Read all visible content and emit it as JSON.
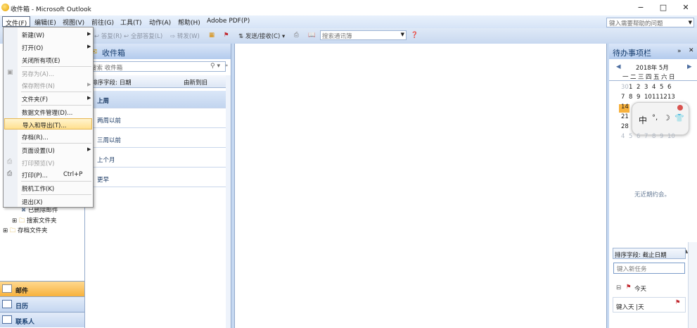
{
  "window": {
    "title": "收件箱 - Microsoft Outlook",
    "controls": [
      "−",
      "□",
      "✕"
    ]
  },
  "menubar": {
    "items": [
      "文件(F)",
      "编辑(E)",
      "视图(V)",
      "前往(G)",
      "工具(T)",
      "动作(A)",
      "帮助(H)",
      "Adobe PDF(P)"
    ],
    "help_placeholder": "键入需要帮助的问题"
  },
  "toolbar": {
    "reply": "答复(R)",
    "reply_all": "全部答复(L)",
    "forward": "转发(W)",
    "send_receive": "发送/接收(C)",
    "contact_search_placeholder": "搜索通讯簿"
  },
  "file_menu": {
    "items": [
      {
        "label": "新建(W)",
        "submenu": true
      },
      {
        "label": "打开(O)",
        "submenu": true
      },
      {
        "label": "关闭所有项(E)"
      },
      {
        "label": "另存为(A)...",
        "disabled": true
      },
      {
        "label": "保存附件(N)",
        "disabled": true,
        "submenu": true
      },
      {
        "label": "文件夹(F)",
        "submenu": true
      },
      {
        "label": "数据文件管理(D)..."
      },
      {
        "label": "导入和导出(T)...",
        "highlighted": true
      },
      {
        "label": "存档(R)..."
      },
      {
        "label": "页面设置(U)",
        "submenu": true
      },
      {
        "label": "打印预览(V)",
        "disabled": true
      },
      {
        "label": "打印(P)...",
        "shortcut": "Ctrl+P"
      },
      {
        "label": "脱机工作(K)"
      },
      {
        "label": "退出(X)"
      }
    ]
  },
  "nav": {
    "folders": [
      "已删除邮件",
      "搜索文件夹",
      "存档文件夹"
    ],
    "buttons": [
      "邮件",
      "日历",
      "联系人"
    ]
  },
  "inbox": {
    "title": "收件箱",
    "search_placeholder": "搜索 收件箱",
    "sort_label": "排序字段: 日期",
    "sort_order": "由新到旧",
    "groups": [
      "上周",
      "两周以前",
      "三周以前",
      "上个月",
      "更早"
    ]
  },
  "todo": {
    "title": "待办事项栏",
    "month": "2018年 5月",
    "weekdays": [
      "一",
      "二",
      "三",
      "四",
      "五",
      "六",
      "日"
    ],
    "weeks": [
      [
        "30",
        "1",
        "2",
        "3",
        "4",
        "5",
        "6"
      ],
      [
        "7",
        "8",
        "9",
        "10",
        "11",
        "12",
        "13"
      ],
      [
        "14",
        "",
        "",
        "",
        "",
        "",
        ""
      ],
      [
        "21",
        "",
        "",
        "",
        "",
        "",
        ""
      ],
      [
        "28",
        "",
        "",
        "",
        "",
        "",
        ""
      ],
      [
        "4",
        "5",
        "6",
        "7",
        "8",
        "9",
        "10"
      ]
    ],
    "today": "14",
    "no_appointments": "无近期约会。",
    "task_sort": "排序字段: 截止日期",
    "new_task_placeholder": "键入新任务",
    "today_group": "今天",
    "ime_text": "键入天 |天"
  },
  "ime": {
    "mode": "中"
  },
  "colors": {
    "highlight": "#ffe08f",
    "accent": "#153c6e",
    "workspace": "#c5d8f1"
  }
}
